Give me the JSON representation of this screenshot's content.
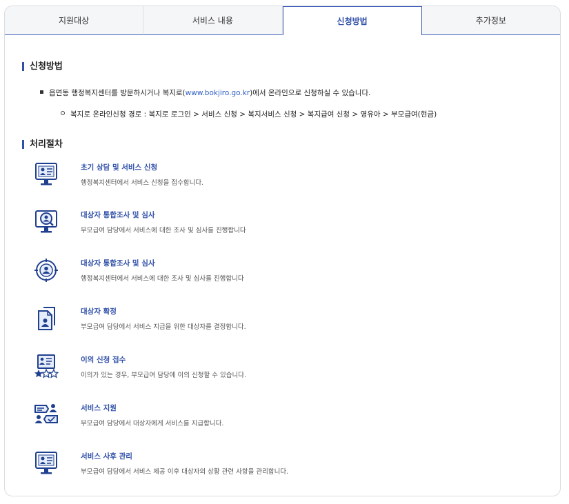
{
  "tabs": [
    {
      "label": "지원대상"
    },
    {
      "label": "서비스 내용"
    },
    {
      "label": "신청방법"
    },
    {
      "label": "추가정보"
    }
  ],
  "apply": {
    "title": "신청방법",
    "bullet_pre": "읍면동 행정복지센터를 방문하시거나 복지로(",
    "bullet_link": "www.bokjiro.go.kr",
    "bullet_post": ")에서 온라인으로 신청하실 수 있습니다.",
    "sub_bullet": "복지로 온라인신청 경로 : 복지로 로그인 > 서비스 신청 > 복지서비스 신청 > 복지급여 신청 > 영유아 > 부모급여(현금)"
  },
  "process": {
    "title": "처리절차",
    "steps": [
      {
        "title": "초기 상담 및 서비스 신청",
        "desc": "행정복지센터에서 서비스 신청을 접수합니다.",
        "icon": "monitor-profile-icon"
      },
      {
        "title": "대상자 통합조사 및 심사",
        "desc": "부모급여 담당에서 서비스에 대한 조사 및 심사를 진행합니다",
        "icon": "monitor-search-icon"
      },
      {
        "title": "대상자 통합조사 및 심사",
        "desc": "행정복지센터에서 서비스에 대한 조사 및 심사를 진행합니다",
        "icon": "target-person-icon"
      },
      {
        "title": "대상자 확정",
        "desc": "부모급여 담당에서 서비스 지급을 위한 대상자를 결정합니다.",
        "icon": "document-person-icon"
      },
      {
        "title": "이의 신청 접수",
        "desc": "이의가 있는 경우, 부모급여 담당에 이의 신청할 수 있습니다.",
        "icon": "profile-stars-icon"
      },
      {
        "title": "서비스 지원",
        "desc": "부모급여 담당에서 대상자에게 서비스를 지급합니다.",
        "icon": "exchange-person-icon"
      },
      {
        "title": "서비스 사후 관리",
        "desc": "부모급여 담당에서 서비스 제공 이후 대상자의 상황 관련 사항을 관리합니다.",
        "icon": "monitor-profile-icon"
      }
    ]
  }
}
